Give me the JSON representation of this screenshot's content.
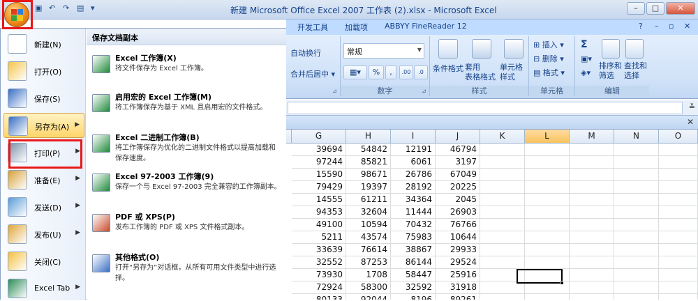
{
  "window": {
    "title": "新建 Microsoft Office Excel 2007 工作表 (2).xlsx - Microsoft Excel",
    "controls": [
      "–",
      "□",
      "✕"
    ]
  },
  "qat": {
    "icons": [
      "save-icon",
      "undo-icon",
      "redo-icon",
      "preview-icon",
      "customize-icon"
    ]
  },
  "ribbon_tabs": [
    "开发工具",
    "加载项",
    "ABBYY FineReader 12"
  ],
  "help_glyph": "?",
  "ribbon": {
    "alignment_fragments": [
      "自动换行",
      "合并后居中 ▾"
    ],
    "number": {
      "format": "常规",
      "group_label": "数字",
      "percent": "%",
      "comma": ",",
      "inc_decimal": ".00",
      "dec_decimal": ".0"
    },
    "styles": {
      "group_label": "样式",
      "conditional": "条件格式",
      "as_table": "套用\n表格格式",
      "cell_style": "单元格\n样式"
    },
    "cells": {
      "group_label": "单元格",
      "insert": "插入",
      "delete": "删除",
      "format": "格式"
    },
    "editing": {
      "group_label": "编辑",
      "sum": "Σ",
      "sort_filter": "排序和\n筛选",
      "find_select": "查找和\n选择"
    }
  },
  "grid": {
    "columns": [
      "G",
      "H",
      "I",
      "J",
      "K",
      "L",
      "M",
      "N",
      "O"
    ],
    "selected_column": "L",
    "rows": [
      [
        39694,
        54842,
        12191,
        46794
      ],
      [
        97244,
        85821,
        6061,
        3197
      ],
      [
        15590,
        98671,
        26786,
        67049
      ],
      [
        79429,
        19397,
        28192,
        20225
      ],
      [
        14555,
        61211,
        34364,
        2045
      ],
      [
        94353,
        32604,
        11444,
        26903
      ],
      [
        49100,
        10594,
        70432,
        76766
      ],
      [
        5211,
        43574,
        75983,
        10644
      ],
      [
        33639,
        76614,
        38867,
        29933
      ],
      [
        32552,
        87253,
        86144,
        29524
      ],
      [
        73930,
        1708,
        58447,
        25916
      ],
      [
        72924,
        58300,
        32592,
        31918
      ],
      [
        80133,
        92044,
        8196,
        89261
      ]
    ]
  },
  "office_menu": {
    "items": [
      {
        "label": "新建(N)",
        "icon": "new-document-icon",
        "has_arrow": false
      },
      {
        "label": "打开(O)",
        "icon": "open-folder-icon",
        "has_arrow": false
      },
      {
        "label": "保存(S)",
        "icon": "save-icon",
        "has_arrow": false
      },
      {
        "label": "另存为(A)",
        "icon": "save-as-icon",
        "has_arrow": true
      },
      {
        "label": "打印(P)",
        "icon": "print-icon",
        "has_arrow": true
      },
      {
        "label": "准备(E)",
        "icon": "prepare-icon",
        "has_arrow": true
      },
      {
        "label": "发送(D)",
        "icon": "send-icon",
        "has_arrow": true
      },
      {
        "label": "发布(U)",
        "icon": "publish-icon",
        "has_arrow": true
      },
      {
        "label": "关闭(C)",
        "icon": "close-folder-icon",
        "has_arrow": false
      },
      {
        "label": "Excel Tab",
        "icon": "excel-tab-icon",
        "has_arrow": true
      }
    ],
    "active_index": 3,
    "submenu_header": "保存文档副本",
    "submenu": [
      {
        "title": "Excel 工作簿(X)",
        "desc": "将文件保存为 Excel 工作簿。",
        "icon": "excel-workbook-icon"
      },
      {
        "title": "启用宏的 Excel 工作簿(M)",
        "desc": "将工作簿保存为基于 XML 且启用宏的文件格式。",
        "icon": "macro-workbook-icon"
      },
      {
        "title": "Excel 二进制工作簿(B)",
        "desc": "将工作簿保存为优化的二进制文件格式以提高加载和保存速度。",
        "icon": "binary-workbook-icon"
      },
      {
        "title": "Excel 97-2003 工作簿(9)",
        "desc": "保存一个与 Excel 97-2003 完全兼容的工作簿副本。",
        "icon": "legacy-workbook-icon"
      },
      {
        "title": "PDF 或 XPS(P)",
        "desc": "发布工作簿的 PDF 或 XPS 文件格式副本。",
        "icon": "pdf-xps-icon"
      },
      {
        "title": "其他格式(O)",
        "desc": "打开“另存为”对话框，从所有可用文件类型中进行选择。",
        "icon": "other-formats-icon"
      }
    ]
  },
  "colors": {
    "accent": "#15428b",
    "highlight": "#ffd56a",
    "annotation": "#e81818"
  }
}
